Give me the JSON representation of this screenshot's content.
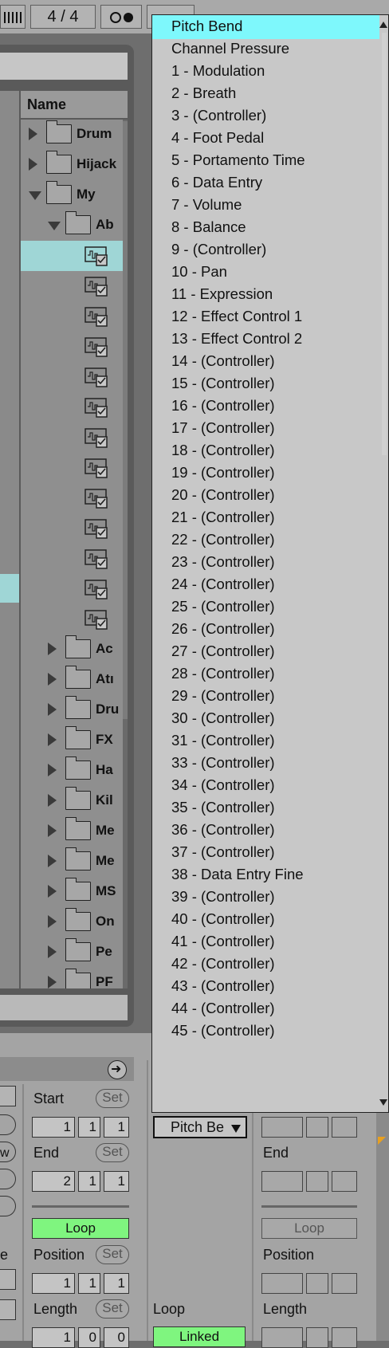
{
  "transport": {
    "time_signature": "4  /  4"
  },
  "browser": {
    "name_header": "Name",
    "items": [
      {
        "label": "Drum",
        "kind": "folder",
        "expanded": false
      },
      {
        "label": "Hijack",
        "kind": "folder",
        "expanded": false
      },
      {
        "label": "My",
        "kind": "folder",
        "expanded": true
      },
      {
        "label": "Ab",
        "kind": "folder",
        "expanded": true
      },
      {
        "label": "",
        "kind": "clip",
        "selected": true
      },
      {
        "label": "",
        "kind": "clip"
      },
      {
        "label": "",
        "kind": "clip"
      },
      {
        "label": "",
        "kind": "clip"
      },
      {
        "label": "",
        "kind": "clip"
      },
      {
        "label": "",
        "kind": "clip"
      },
      {
        "label": "",
        "kind": "clip"
      },
      {
        "label": "",
        "kind": "clip"
      },
      {
        "label": "",
        "kind": "clip"
      },
      {
        "label": "",
        "kind": "clip"
      },
      {
        "label": "",
        "kind": "clip"
      },
      {
        "label": "",
        "kind": "clip"
      },
      {
        "label": "",
        "kind": "clip"
      },
      {
        "label": "Ac",
        "kind": "folder",
        "expanded": false
      },
      {
        "label": "Atı",
        "kind": "folder",
        "expanded": false
      },
      {
        "label": "Dru",
        "kind": "folder",
        "expanded": false
      },
      {
        "label": "FX",
        "kind": "folder",
        "expanded": false
      },
      {
        "label": "Ha",
        "kind": "folder",
        "expanded": false
      },
      {
        "label": "Kil",
        "kind": "folder",
        "expanded": false
      },
      {
        "label": "Me",
        "kind": "folder",
        "expanded": false
      },
      {
        "label": "Me",
        "kind": "folder",
        "expanded": false
      },
      {
        "label": "MS",
        "kind": "folder",
        "expanded": false
      },
      {
        "label": "On",
        "kind": "folder",
        "expanded": false
      },
      {
        "label": "Pe",
        "kind": "folder",
        "expanded": false
      },
      {
        "label": "PF",
        "kind": "folder",
        "expanded": false
      }
    ]
  },
  "clip_view": {
    "start_label": "Start",
    "end_label": "End",
    "position_label": "Position",
    "length_label": "Length",
    "set_label": "Set",
    "loop_label": "Loop",
    "linked_label": "Linked",
    "start_values": [
      "1",
      "1",
      "1"
    ],
    "end_values": [
      "2",
      "1",
      "1"
    ],
    "position_values": [
      "1",
      "1",
      "1"
    ],
    "length_values": [
      "1",
      "0",
      "0"
    ],
    "left_partial_labels": [
      "e",
      "w"
    ],
    "envelope_selector": "Pitch Be",
    "loop_color": "#7ff57f"
  },
  "dropdown": {
    "selected_index": 0,
    "highlight_color": "#7ef8fc",
    "items": [
      "Pitch Bend",
      "Channel Pressure",
      "1 - Modulation",
      "2 - Breath",
      "3 - (Controller)",
      "4 - Foot Pedal",
      "5 - Portamento Time",
      "6 - Data Entry",
      "7 - Volume",
      "8 - Balance",
      "9 - (Controller)",
      "10 - Pan",
      "11 - Expression",
      "12 - Effect Control 1",
      "13 - Effect Control 2",
      "14 - (Controller)",
      "15 - (Controller)",
      "16 - (Controller)",
      "17 - (Controller)",
      "18 - (Controller)",
      "19 - (Controller)",
      "20 - (Controller)",
      "21 - (Controller)",
      "22 - (Controller)",
      "23 - (Controller)",
      "24 - (Controller)",
      "25 - (Controller)",
      "26 - (Controller)",
      "27 - (Controller)",
      "28 - (Controller)",
      "29 - (Controller)",
      "30 - (Controller)",
      "31 - (Controller)",
      "33 - (Controller)",
      "34 - (Controller)",
      "35 - (Controller)",
      "36 - (Controller)",
      "37 - (Controller)",
      "38 - Data Entry Fine",
      "39 - (Controller)",
      "40 - (Controller)",
      "41 - (Controller)",
      "42 - (Controller)",
      "43 - (Controller)",
      "44 - (Controller)",
      "45 - (Controller)"
    ]
  }
}
